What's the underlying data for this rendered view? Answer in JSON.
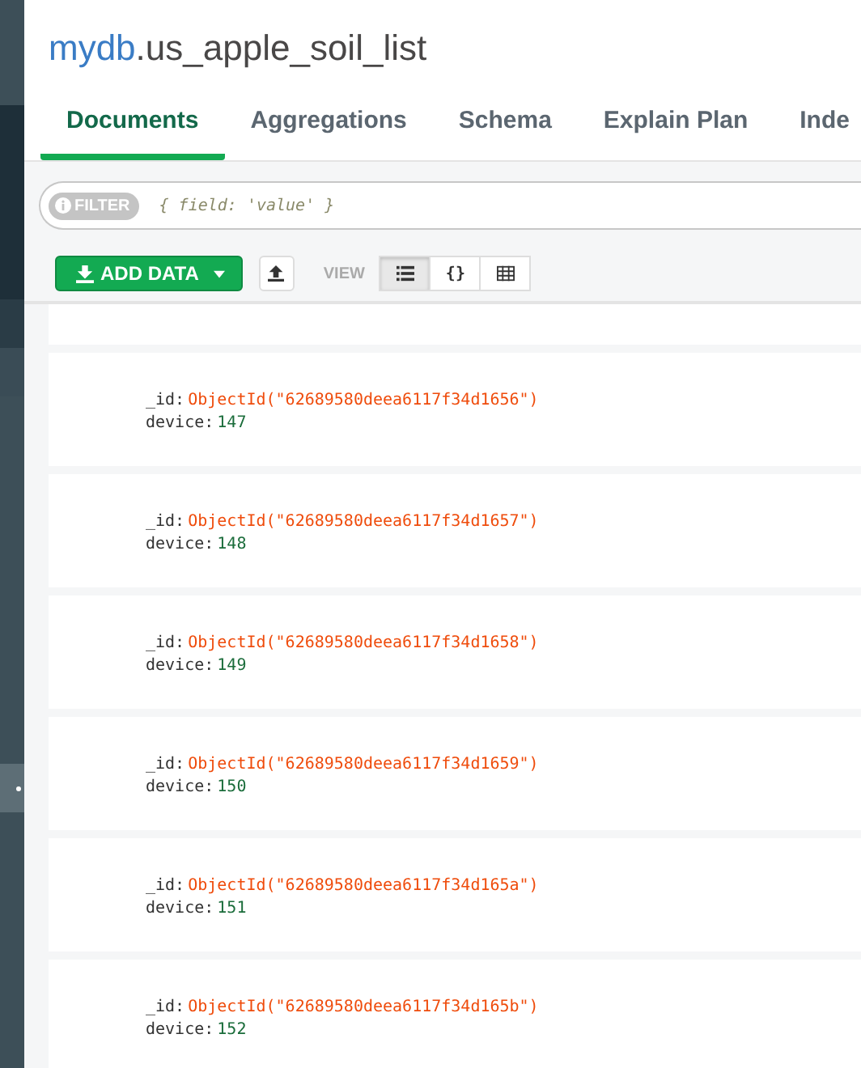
{
  "title": {
    "db": "mydb",
    "collection": ".us_apple_soil_list"
  },
  "tabs": [
    {
      "label": "Documents",
      "selected": true
    },
    {
      "label": "Aggregations",
      "selected": false
    },
    {
      "label": "Schema",
      "selected": false
    },
    {
      "label": "Explain Plan",
      "selected": false
    },
    {
      "label": "Inde",
      "selected": false
    }
  ],
  "filter": {
    "label": "FILTER",
    "placeholder": "{ field: 'value' }"
  },
  "toolbar": {
    "add_data": "ADD DATA",
    "view_label": "VIEW",
    "views": [
      {
        "kind": "list",
        "selected": true
      },
      {
        "kind": "json",
        "label": "{}",
        "selected": false
      },
      {
        "kind": "table",
        "selected": false
      }
    ]
  },
  "documents": [
    {
      "id_key": "_id:",
      "id_value": "ObjectId(\"62689580deea6117f34d1656\")",
      "device_key": "device:",
      "device_value": "147"
    },
    {
      "id_key": "_id:",
      "id_value": "ObjectId(\"62689580deea6117f34d1657\")",
      "device_key": "device:",
      "device_value": "148"
    },
    {
      "id_key": "_id:",
      "id_value": "ObjectId(\"62689580deea6117f34d1658\")",
      "device_key": "device:",
      "device_value": "149"
    },
    {
      "id_key": "_id:",
      "id_value": "ObjectId(\"62689580deea6117f34d1659\")",
      "device_key": "device:",
      "device_value": "150"
    },
    {
      "id_key": "_id:",
      "id_value": "ObjectId(\"62689580deea6117f34d165a\")",
      "device_key": "device:",
      "device_value": "151"
    },
    {
      "id_key": "_id:",
      "id_value": "ObjectId(\"62689580deea6117f34d165b\")",
      "device_key": "device:",
      "device_value": "152"
    }
  ]
}
